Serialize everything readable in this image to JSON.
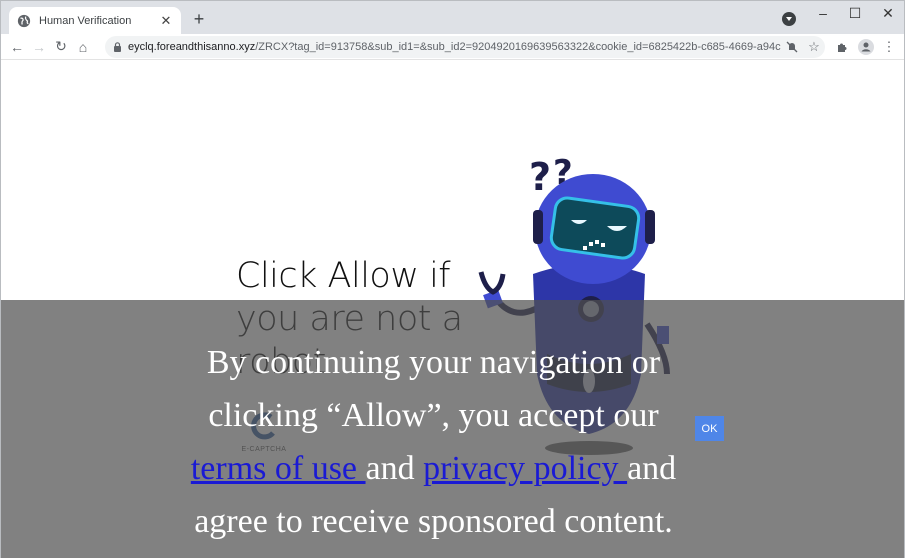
{
  "browser": {
    "tab": {
      "title": "Human Verification",
      "favicon": "globe-icon",
      "close_glyph": "✕"
    },
    "new_tab_glyph": "+",
    "window_controls": {
      "minimize": "–",
      "maximize": "☐",
      "close": "✕"
    },
    "nav": {
      "back": "←",
      "forward": "→",
      "reload": "↻",
      "home": "⌂"
    },
    "address_bar": {
      "host": "eyclq.foreandthisanno.xyz",
      "path": "/ZRCX?tag_id=913758&sub_id1=&sub_id2=9204920169639563322&cookie_id=6825422b-c685-4669-a94c-83c82ecd..."
    },
    "toolbar_icons": [
      "notifications-blocked-icon",
      "bookmark-star-icon",
      "extensions-icon",
      "profile-icon",
      "menu-icon"
    ]
  },
  "page": {
    "headline": "Click Allow if you are not a robot",
    "captcha_label": "E-CAPTCHA",
    "consent": {
      "line1": "By continuing your navigation or clicking “Allow”, you accept our",
      "terms_link": "terms of use ",
      "and1": "and ",
      "privacy_link": "privacy policy ",
      "and2": "and agree to receive sponsored content."
    },
    "ok_button": "OK",
    "colors": {
      "overlay": "#808080",
      "ok_button": "#4f86e8",
      "link": "#1a1ad4",
      "robot_body": "#3f4bd1",
      "robot_visor": "#0d4a5a"
    }
  }
}
